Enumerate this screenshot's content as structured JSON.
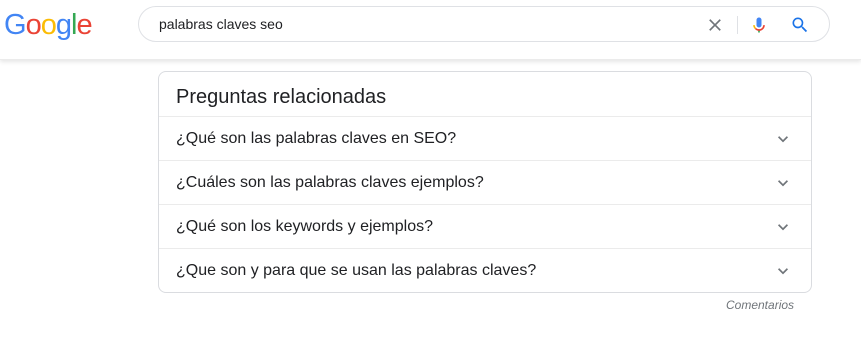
{
  "header": {
    "logo": {
      "letters": [
        {
          "ch": "G",
          "color": "#4285F4"
        },
        {
          "ch": "o",
          "color": "#EA4335"
        },
        {
          "ch": "o",
          "color": "#FBBC05"
        },
        {
          "ch": "g",
          "color": "#4285F4"
        },
        {
          "ch": "l",
          "color": "#34A853"
        },
        {
          "ch": "e",
          "color": "#EA4335"
        }
      ]
    },
    "search": {
      "value": "palabras claves seo",
      "clear_icon": "close-icon",
      "mic_icon": "microphone-icon",
      "search_icon": "search-icon",
      "accent_color": "#1a73e8"
    }
  },
  "related_questions": {
    "title": "Preguntas relacionadas",
    "items": [
      {
        "question": "¿Qué son las palabras claves en SEO?",
        "icon": "chevron-down-icon"
      },
      {
        "question": "¿Cuáles son las palabras claves ejemplos?",
        "icon": "chevron-down-icon"
      },
      {
        "question": "¿Qué son los keywords y ejemplos?",
        "icon": "chevron-down-icon"
      },
      {
        "question": "¿Que son y para que se usan las palabras claves?",
        "icon": "chevron-down-icon"
      }
    ],
    "feedback_label": "Comentarios"
  }
}
